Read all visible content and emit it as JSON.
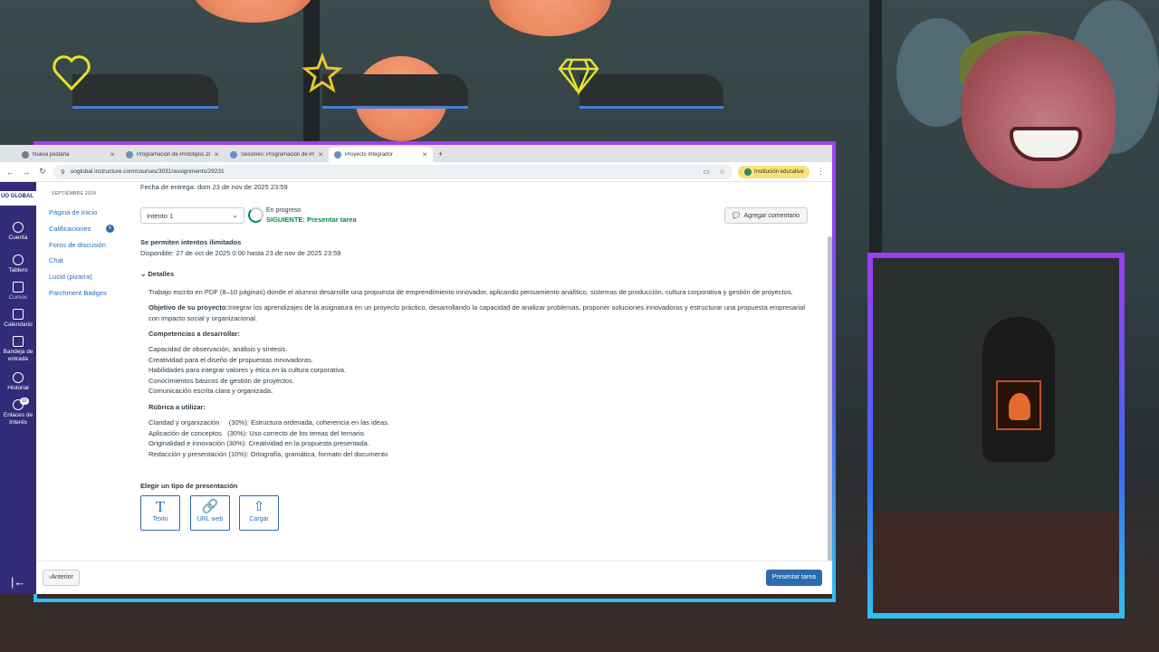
{
  "browser": {
    "tabs": [
      {
        "title": "Nueva pestaña",
        "active": false
      },
      {
        "title": "Programación de Prototipos 2D",
        "active": false
      },
      {
        "title": "Sesiones: Programación de Pro",
        "active": false
      },
      {
        "title": "Proyecto Integrador",
        "active": true
      }
    ],
    "new_tab": "+",
    "url": "uoglobal.instructure.com/courses/3031/assignments/29231",
    "profile": "Institución educativa"
  },
  "global_nav": {
    "logo": "UO GLOBAL",
    "items": [
      {
        "label": "Cuenta",
        "icon": "account-icon"
      },
      {
        "label": "Tablero",
        "icon": "dashboard-icon"
      },
      {
        "label": "Cursos",
        "icon": "courses-icon"
      },
      {
        "label": "Calendario",
        "icon": "calendar-icon"
      },
      {
        "label": "Bandeja de entrada",
        "icon": "inbox-icon"
      },
      {
        "label": "Historial",
        "icon": "history-icon"
      },
      {
        "label": "Enlaces de Interés",
        "icon": "links-icon",
        "badge": "10"
      }
    ],
    "collapse": "|←"
  },
  "course_nav": {
    "term": "SEPTIEMBRE 2024",
    "links": [
      "Página de Inicio",
      "Calificaciones",
      "Foros de discusión",
      "Chat",
      "Lucid (pizarra)",
      "Parchment Badges"
    ],
    "grades_badge": "6"
  },
  "assignment": {
    "due": "Fecha de entrega: dom 23 de nov de 2025 23:59",
    "attempt": "Intento 1",
    "status": "En progreso",
    "next": "SIGUIENTE: Presentar tarea",
    "comment_button": "Agregar comentario",
    "attempts_heading": "Se permiten intentos ilimitados",
    "available": "Disponible: 27 de oct de 2025 0:00 hasta 23 de nov de 2025 23:59",
    "details_toggle": "Detalles",
    "description": "Trabajo escrito en PDF (8–10 páginas) donde el alumno desarrolle una propuesta de emprendimiento innovador, aplicando pensamiento analítico, sistemas de producción, cultura corporativa y gestión de proyectos.",
    "objective_label": "Objetivo de su proyecto:",
    "objective_line1": "Integrar los aprendizajes de la asignatura en un proyecto práctico, desarrollando la capacidad de analizar problemas, proponer soluciones innovadoras y estructurar una propuesta empresarial",
    "objective_line2": "con impacto social y organizacional.",
    "competencies_heading": "Competencias a desarrollar:",
    "competencies": [
      "Capacidad de observación, análisis y síntesis.",
      "Creatividad para el diseño de propuestas innovadoras.",
      "Habilidades para integrar valores y ética en la cultura corporativa.",
      "Conocimientos básicos de gestión de proyectos.",
      "Comunicación escrita clara y organizada."
    ],
    "rubric_heading": "Rúbrica a utilizar:",
    "rubric": [
      "Claridad y organización     (30%): Estructura ordenada, coherencia en las ideas.",
      "Aplicación de conceptos   (30%): Uso correcto de los temas del temario.",
      "Originalidad e innovación (30%): Creatividad en la propuesta presentada.",
      "Redacción y presentación (10%): Ortografía, gramática, formato del documento"
    ],
    "submission_heading": "Elegir un tipo de presentación",
    "submission_types": [
      {
        "label": "Texto",
        "glyph": "T",
        "icon": "text-icon"
      },
      {
        "label": "URL web",
        "glyph": "🔗",
        "icon": "link-icon"
      },
      {
        "label": "Cargar",
        "glyph": "⇧",
        "icon": "upload-icon"
      }
    ]
  },
  "footer": {
    "prev": "Anterior",
    "submit": "Presentar tarea"
  },
  "colors": {
    "canvas_nav": "#332a7a",
    "link": "#2b6cb0",
    "success": "#0b874b",
    "overlay_frame_top": "#a13ff0",
    "overlay_frame_bottom": "#2fbff2"
  }
}
